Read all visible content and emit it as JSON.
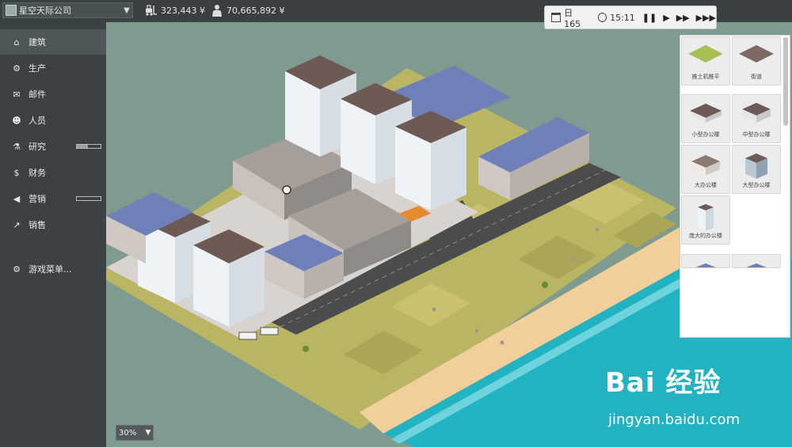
{
  "header": {
    "company_name": "星空天际公司",
    "money": "323,443 ¥",
    "value": "70,665,892 ¥"
  },
  "time": {
    "day": "日 165",
    "clock": "15:11",
    "controls": [
      "❚❚",
      "▶",
      "▶▶",
      "▶▶▶"
    ]
  },
  "sidebar": {
    "items": [
      {
        "label": "建筑",
        "icon": "home-icon",
        "glyph": "⌂"
      },
      {
        "label": "生产",
        "icon": "forklift-icon",
        "glyph": "⚙"
      },
      {
        "label": "邮件",
        "icon": "mail-icon",
        "glyph": "✉"
      },
      {
        "label": "人员",
        "icon": "people-icon",
        "glyph": "☻"
      },
      {
        "label": "研究",
        "icon": "flask-icon",
        "glyph": "⚗",
        "progress": 0.45
      },
      {
        "label": "财务",
        "icon": "money-icon",
        "glyph": "$"
      },
      {
        "label": "营销",
        "icon": "megaphone-icon",
        "glyph": "◀",
        "progress": 0.0
      },
      {
        "label": "销售",
        "icon": "chart-icon",
        "glyph": "↗"
      },
      {
        "label": "游戏菜单...",
        "icon": "gear-icon",
        "glyph": "⚙"
      }
    ]
  },
  "build_panel": {
    "items": [
      {
        "label": "推土机推平"
      },
      {
        "label": "街道"
      },
      {
        "label": "小型办公楼"
      },
      {
        "label": "中型办公楼"
      },
      {
        "label": "大办公楼"
      },
      {
        "label": "大型办公楼"
      },
      {
        "label": "庞大的办公楼"
      },
      {
        "label": ""
      },
      {
        "label": ""
      }
    ]
  },
  "zoom": {
    "value": "30%"
  },
  "watermark": {
    "brand": "Bai 经验",
    "url": "jingyan.baidu.com"
  },
  "colors": {
    "topbar": "#3a3f42",
    "sidebar": "#3c4244",
    "grass": "#b7b45f",
    "sea": "#22b3c2",
    "sand": "#f0cf9b",
    "road": "#4a4c4e"
  }
}
